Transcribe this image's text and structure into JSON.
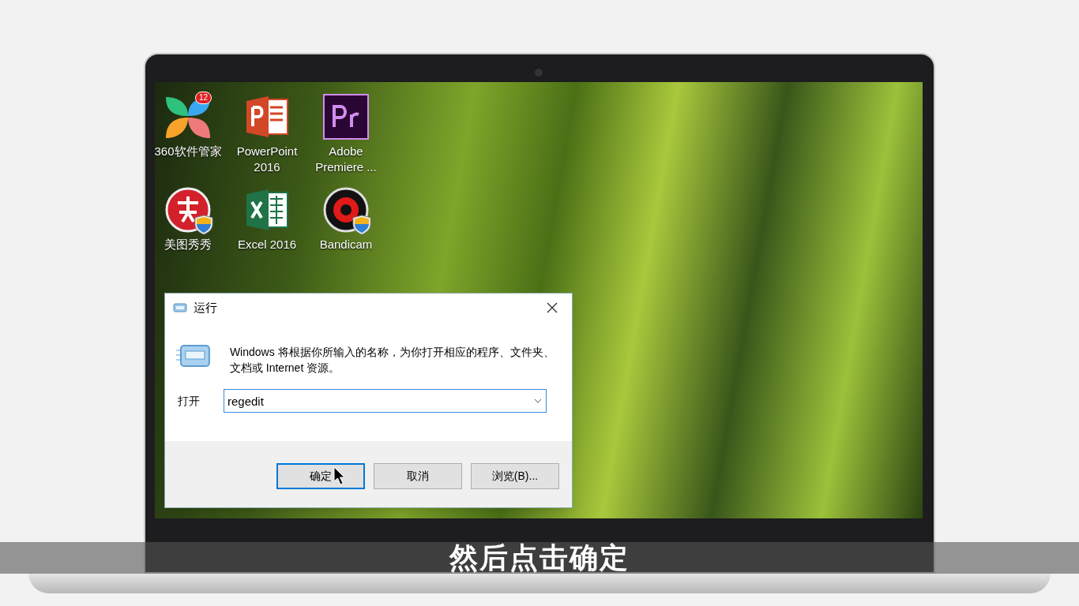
{
  "desktop_icons": [
    {
      "label": "360软件管家",
      "kind": "flower",
      "badge": "12",
      "shield": false
    },
    {
      "label": "PowerPoint 2016",
      "kind": "powerpoint",
      "shield": false
    },
    {
      "label": "Adobe Premiere ...",
      "kind": "premiere",
      "shield": false
    },
    {
      "label": "美图秀秀",
      "kind": "meitu",
      "shield": true
    },
    {
      "label": "Excel 2016",
      "kind": "excel",
      "shield": false
    },
    {
      "label": "Bandicam",
      "kind": "bandicam",
      "shield": true
    }
  ],
  "run_dialog": {
    "title": "运行",
    "description": "Windows 将根据你所输入的名称，为你打开相应的程序、文件夹、文档或 Internet 资源。",
    "open_label": "打开",
    "command_value": "regedit",
    "buttons": [
      {
        "label": "确定",
        "focused": true
      },
      {
        "label": "取消",
        "focused": false
      },
      {
        "label": "浏览(B)...",
        "focused": false
      }
    ]
  },
  "subtitle": "然后点击确定"
}
